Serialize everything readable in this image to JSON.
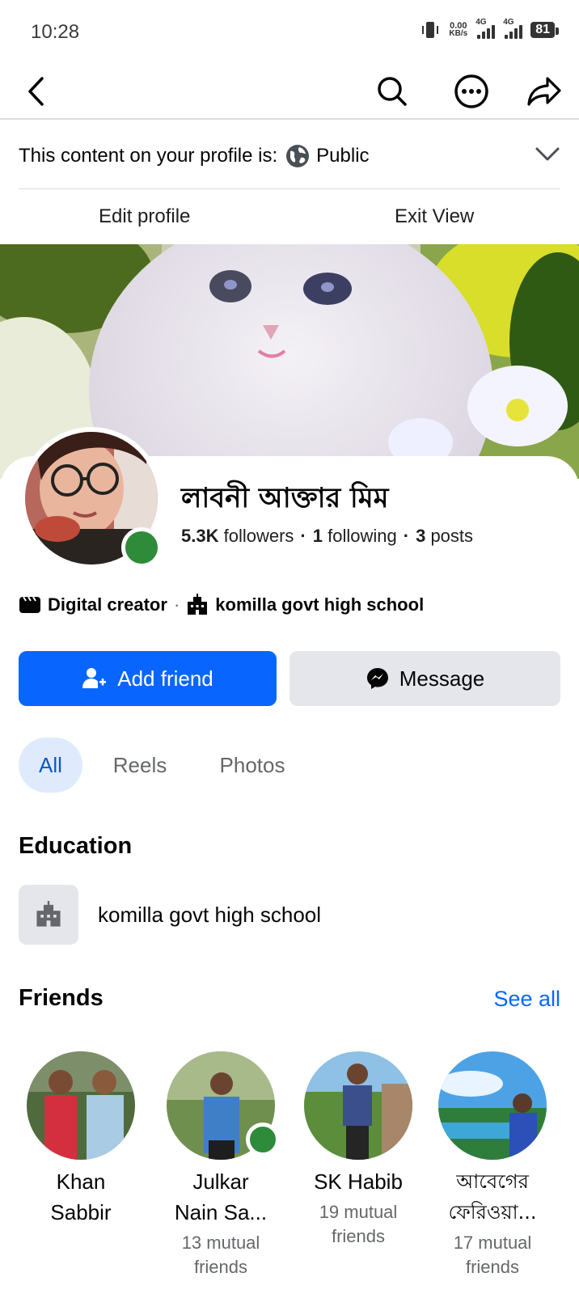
{
  "status_bar": {
    "time": "10:28",
    "speed_value": "0.00",
    "speed_unit": "KB/s",
    "network_1": "4G",
    "network_2": "4G",
    "battery": "81"
  },
  "nav": {
    "back_icon": "chevron-left-icon",
    "search_icon": "search-icon",
    "more_icon": "more-horizontal-icon",
    "share_icon": "share-arrow-icon"
  },
  "privacy": {
    "label": "This content on your profile is:",
    "value": "Public"
  },
  "view_actions": {
    "edit_profile": "Edit profile",
    "exit_view": "Exit View"
  },
  "profile": {
    "name": "লাবনী আক্তার মিম",
    "followers_count": "5.3K",
    "followers_label": "followers",
    "following_count": "1",
    "following_label": "following",
    "posts_count": "3",
    "posts_label": "posts",
    "category": "Digital creator",
    "school": "komilla govt high school",
    "online": true
  },
  "actions": {
    "add_friend": "Add friend",
    "message": "Message"
  },
  "tabs": [
    {
      "label": "All",
      "active": true
    },
    {
      "label": "Reels",
      "active": false
    },
    {
      "label": "Photos",
      "active": false
    }
  ],
  "education": {
    "title": "Education",
    "school": "komilla govt high school"
  },
  "friends": {
    "title": "Friends",
    "see_all": "See all",
    "items": [
      {
        "name_line1": "Khan",
        "name_line2": "Sabbir",
        "mutual_line1": "",
        "mutual_line2": "",
        "online": false
      },
      {
        "name_line1": "Julkar",
        "name_line2": "Nain Sa...",
        "mutual_line1": "13 mutual",
        "mutual_line2": "friends",
        "online": true
      },
      {
        "name_line1": "SK Habib",
        "name_line2": "",
        "mutual_line1": "19 mutual",
        "mutual_line2": "friends",
        "online": false
      },
      {
        "name_line1": "আবেগের",
        "name_line2": "ফেরিওয়া...",
        "mutual_line1": "17 mutual",
        "mutual_line2": "friends",
        "online": false
      }
    ]
  },
  "colors": {
    "primary": "#0866ff",
    "online": "#2e8b3a",
    "secondary_button": "#e4e6eb",
    "active_tab_bg": "#dfebfd"
  }
}
